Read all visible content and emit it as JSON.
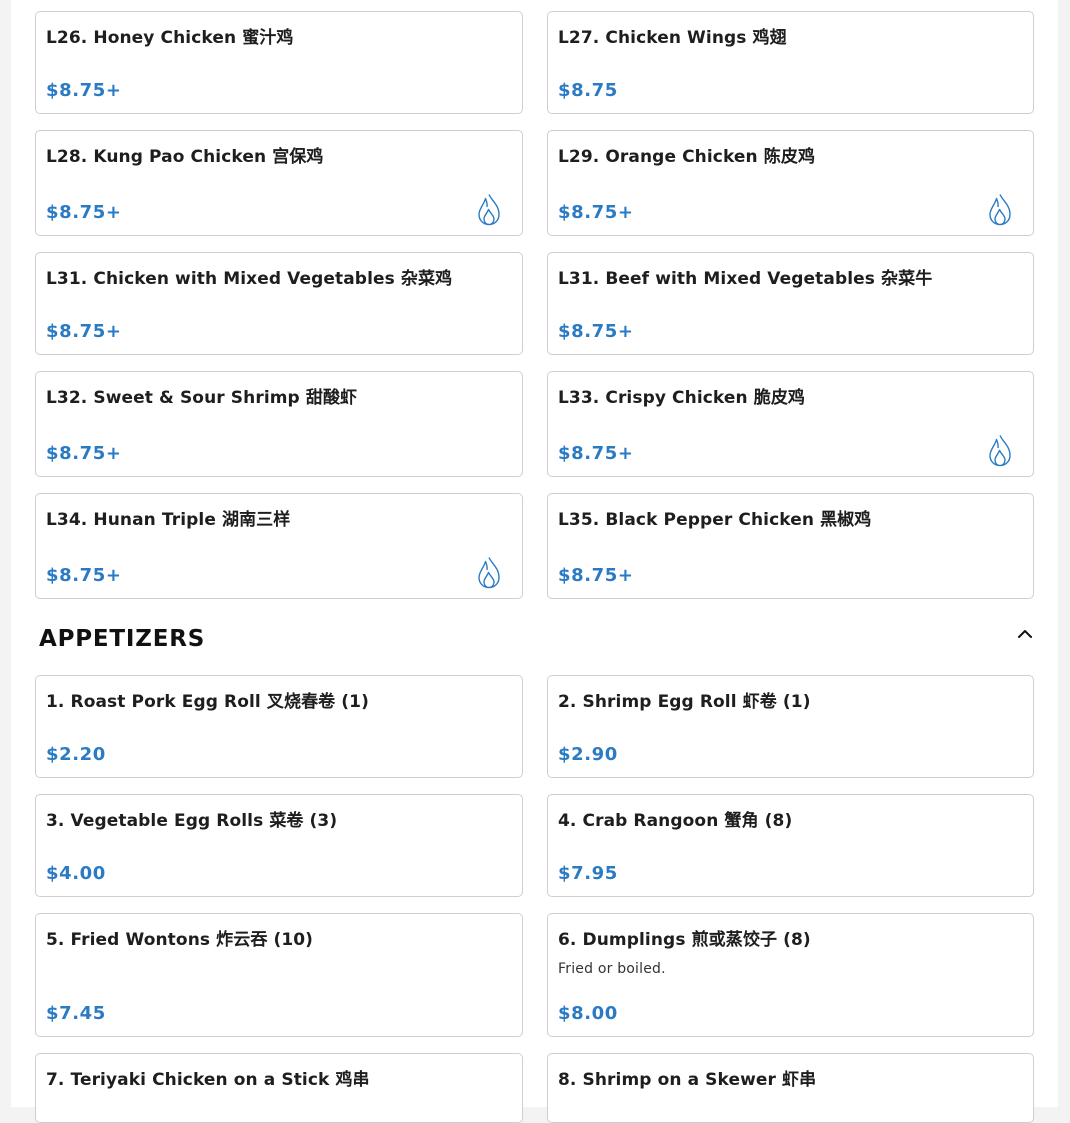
{
  "lunch_items": [
    {
      "name": "L26. Honey Chicken 蜜汁鸡",
      "price": "$8.75+"
    },
    {
      "name": "L27. Chicken Wings 鸡翅",
      "price": "$8.75"
    },
    {
      "name": "L28. Kung Pao Chicken 宫保鸡",
      "price": "$8.75+",
      "icon": "spicy-flame-icon"
    },
    {
      "name": "L29. Orange Chicken 陈皮鸡",
      "price": "$8.75+",
      "icon": "spicy-flame-icon"
    },
    {
      "name": "L31. Chicken with Mixed Vegetables 杂菜鸡",
      "price": "$8.75+"
    },
    {
      "name": "L31. Beef with Mixed Vegetables 杂菜牛",
      "price": "$8.75+"
    },
    {
      "name": "L32. Sweet & Sour Shrimp 甜酸虾",
      "price": "$8.75+"
    },
    {
      "name": "L33. Crispy Chicken 脆皮鸡",
      "price": "$8.75+",
      "icon": "spicy-flame-icon"
    },
    {
      "name": "L34. Hunan Triple 湖南三样",
      "price": "$8.75+",
      "icon": "spicy-flame-icon"
    },
    {
      "name": "L35. Black Pepper Chicken 黑椒鸡",
      "price": "$8.75+"
    }
  ],
  "appetizers": {
    "title": "APPETIZERS",
    "toggle_icon": "chevron-up-icon",
    "items": [
      {
        "name": "1. Roast Pork Egg Roll 叉烧春卷 (1)",
        "price": "$2.20"
      },
      {
        "name": "2. Shrimp Egg Roll 虾卷 (1)",
        "price": "$2.90"
      },
      {
        "name": "3. Vegetable Egg Rolls 菜卷 (3)",
        "price": "$4.00"
      },
      {
        "name": "4. Crab Rangoon 蟹角 (8)",
        "price": "$7.95"
      },
      {
        "name": "5. Fried Wontons 炸云吞 (10)",
        "price": "$7.45"
      },
      {
        "name": "6. Dumplings 煎或蒸饺子 (8)",
        "description": "Fried or boiled.",
        "price": "$8.00"
      },
      {
        "name": "7. Teriyaki Chicken on a Stick 鸡串",
        "price": ""
      },
      {
        "name": "8. Shrimp on a Skewer 虾串",
        "price": ""
      }
    ]
  },
  "colors": {
    "price": "#2b7bc4",
    "spicy_icon": "#2b7bc4"
  }
}
